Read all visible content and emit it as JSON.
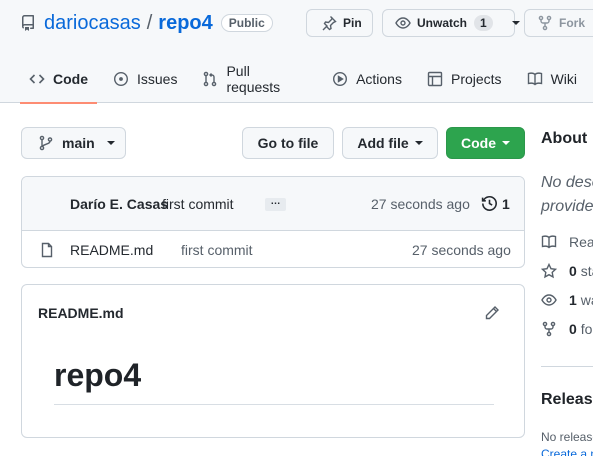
{
  "repo": {
    "owner": "dariocasas",
    "separator": "/",
    "name": "repo4",
    "visibility": "Public"
  },
  "header_actions": {
    "pin": "Pin",
    "unwatch": "Unwatch",
    "watch_count": "1",
    "fork": "Fork"
  },
  "tabs": [
    {
      "label": "Code",
      "icon": "code-icon",
      "selected": true
    },
    {
      "label": "Issues",
      "icon": "issue-icon"
    },
    {
      "label": "Pull requests",
      "icon": "pull-request-icon"
    },
    {
      "label": "Actions",
      "icon": "play-icon"
    },
    {
      "label": "Projects",
      "icon": "table-icon"
    },
    {
      "label": "Wiki",
      "icon": "book-icon"
    }
  ],
  "toolbar": {
    "branch": "main",
    "go_to_file": "Go to file",
    "add_file": "Add file",
    "code": "Code",
    "code_color": "#2da44e"
  },
  "latest_commit": {
    "author": "Darío E. Casas",
    "message": "first commit",
    "ellipsis": "…",
    "time": "27 seconds ago",
    "commit_count": "1"
  },
  "files": [
    {
      "name": "README.md",
      "commit": "first commit",
      "time": "27 seconds ago"
    }
  ],
  "readme": {
    "filename": "README.md",
    "heading": "repo4"
  },
  "sidebar": {
    "about_title": "About",
    "description": [
      "No desc",
      "provide"
    ],
    "items": [
      {
        "icon": "book-icon",
        "count": "",
        "label": "Rea"
      },
      {
        "icon": "star-icon",
        "count": "0",
        "label": "sta"
      },
      {
        "icon": "eye-icon",
        "count": "1",
        "label": "wa"
      },
      {
        "icon": "fork-icon",
        "count": "0",
        "label": "fo"
      }
    ],
    "releases_title": "Release",
    "no_releases": "No release",
    "create_release": "Create a n"
  }
}
